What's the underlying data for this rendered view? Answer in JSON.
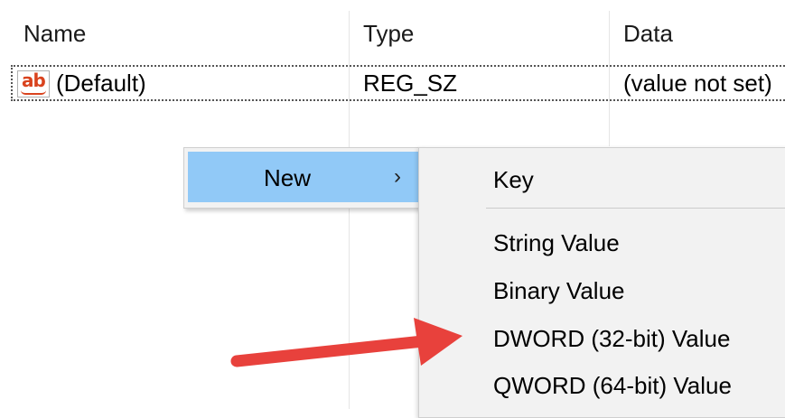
{
  "list": {
    "columns": {
      "name": "Name",
      "type": "Type",
      "data": "Data"
    },
    "rows": [
      {
        "icon": "string-value-icon",
        "icon_text": "ab",
        "name": "(Default)",
        "type": "REG_SZ",
        "data": "(value not set)"
      }
    ]
  },
  "context_menu": {
    "new_label": "New",
    "new_arrow": "›",
    "highlight_color": "#91c9f7"
  },
  "submenu": {
    "items": [
      "Key",
      "String Value",
      "Binary Value",
      "DWORD (32-bit) Value",
      "QWORD (64-bit) Value"
    ]
  },
  "annotation": {
    "arrow_color": "#e8413c",
    "arrow_target": "DWORD (32-bit) Value"
  }
}
